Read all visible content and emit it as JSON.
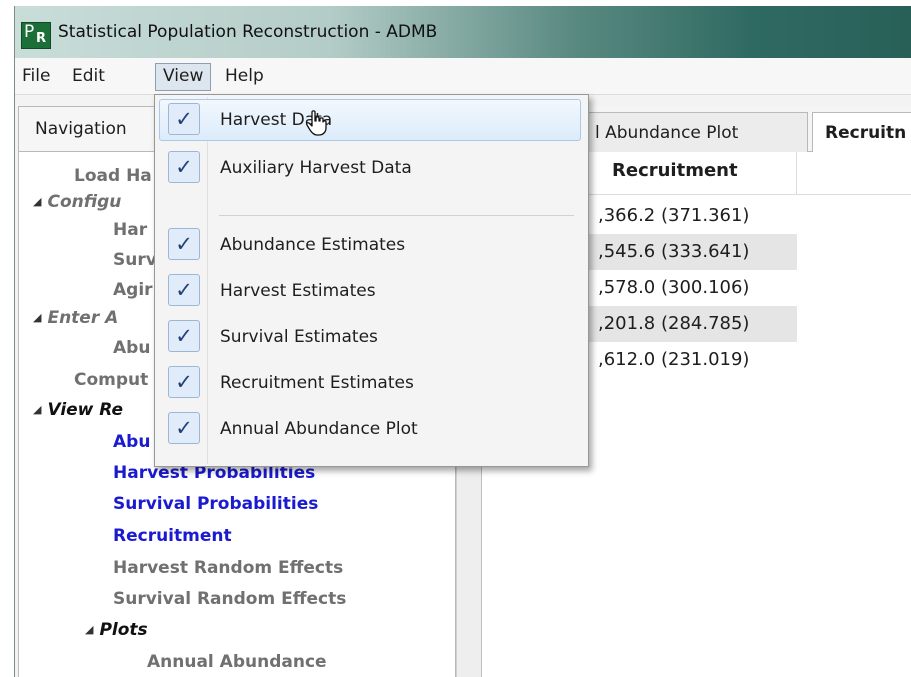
{
  "window": {
    "title": "Statistical Population Reconstruction - ADMB",
    "icon_main": "P",
    "icon_sub": "R"
  },
  "menubar": {
    "items": [
      "File",
      "Edit",
      "View",
      "Help"
    ],
    "active": "View"
  },
  "view_menu": {
    "items": [
      {
        "label": "Harvest Data",
        "checked": true,
        "check": "✓"
      },
      {
        "label": "Auxiliary Harvest Data",
        "checked": true,
        "check": "✓"
      },
      {
        "label": "Abundance Estimates",
        "checked": true,
        "check": "✓"
      },
      {
        "label": "Harvest Estimates",
        "checked": true,
        "check": "✓"
      },
      {
        "label": "Survival Estimates",
        "checked": true,
        "check": "✓"
      },
      {
        "label": "Recruitment Estimates",
        "checked": true,
        "check": "✓"
      },
      {
        "label": "Annual Abundance Plot",
        "checked": true,
        "check": "✓"
      }
    ],
    "hovered": "Harvest Data"
  },
  "navigation": {
    "header": "Navigation",
    "tree": {
      "load": "Load Ha",
      "configure": "Configu",
      "harvest": "Har",
      "survival": "Surv",
      "aging": "Agir",
      "enter_aux": "Enter A",
      "abundance_input": "Abu",
      "compute": "Comput",
      "view_results": "View Re",
      "abundance_result": "Abu",
      "harvest_probabilities": "Harvest Probabilities",
      "survival_probabilities": "Survival Probabilities",
      "recruitment": "Recruitment",
      "harvest_random_effects": "Harvest Random Effects",
      "survival_random_effects": "Survival Random Effects",
      "plots": "Plots",
      "annual_abundance": "Annual Abundance"
    }
  },
  "tabs": [
    {
      "label": "l Abundance Plot",
      "selected": false
    },
    {
      "label": "Recruitn",
      "selected": true
    }
  ],
  "recruitment_table": {
    "header": "Recruitment",
    "rows": [
      ",366.2 (371.361)",
      ",545.6 (333.641)",
      ",578.0 (300.106)",
      ",201.8 (284.785)",
      ",612.0 (231.019)"
    ]
  },
  "colors": {
    "link_blue": "#1a1ad0",
    "disabled_grey": "#707070",
    "titlebar_dark": "#286058",
    "menu_highlight": "#dcebfa"
  }
}
